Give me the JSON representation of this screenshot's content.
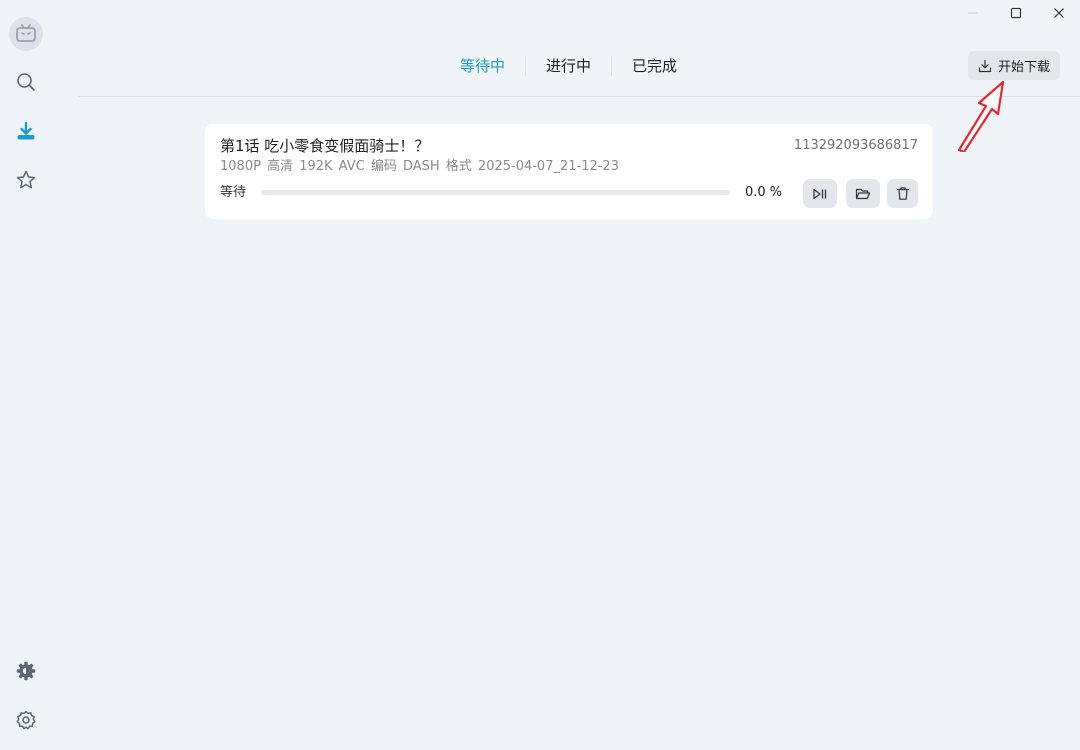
{
  "tabs": [
    {
      "label": "等待中",
      "active": true
    },
    {
      "label": "进行中",
      "active": false
    },
    {
      "label": "已完成",
      "active": false
    }
  ],
  "toolbar": {
    "start_download_label": "开始下载"
  },
  "sidebar": {
    "items": [
      {
        "icon": "search-icon"
      },
      {
        "icon": "download-icon",
        "active": true
      },
      {
        "icon": "star-icon"
      }
    ],
    "bottom": [
      {
        "icon": "theme-gear-icon"
      },
      {
        "icon": "settings-icon"
      }
    ]
  },
  "download_item": {
    "title": "第1话 吃小零食变假面骑士！？",
    "id": "113292093686817",
    "meta": "1080P 高清  192K  AVC 编码  DASH 格式  2025-04-07_21-12-23",
    "status": "等待",
    "progress": 0.0,
    "progress_text": "0.0 %"
  },
  "colors": {
    "accent": "#1a9ad6",
    "annotation": "#e8262d"
  }
}
